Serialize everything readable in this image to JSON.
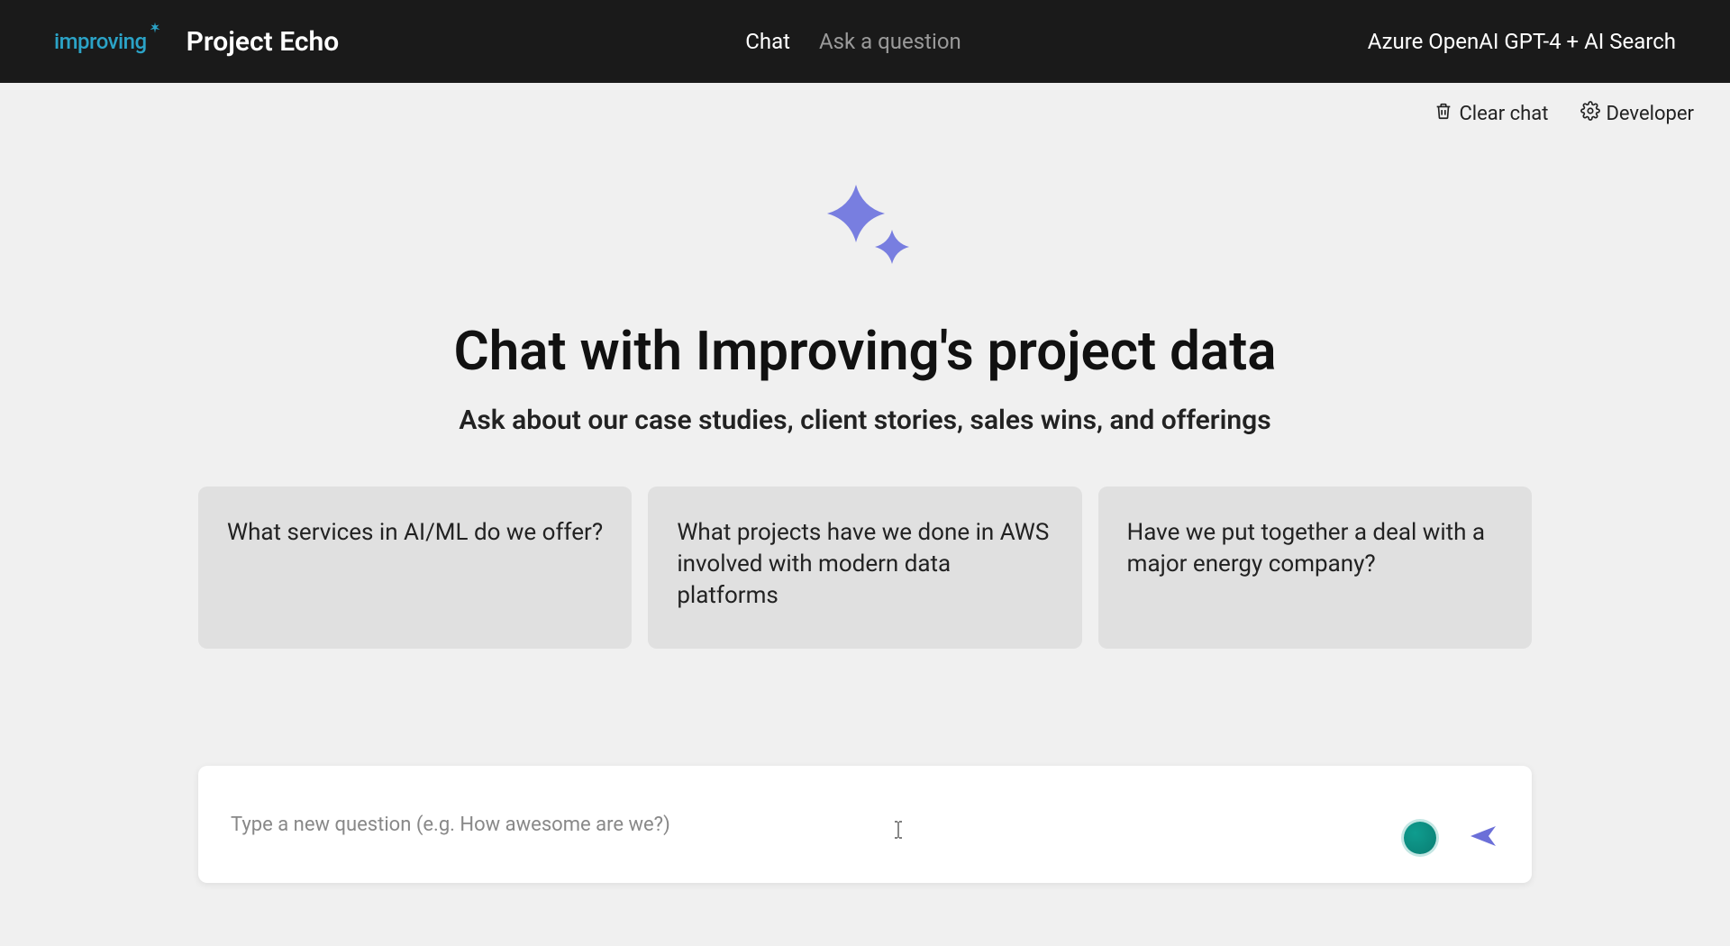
{
  "header": {
    "logo_text": "improving",
    "project_title": "Project Echo",
    "nav": {
      "chat": "Chat",
      "ask": "Ask a question"
    },
    "right_label": "Azure OpenAI GPT-4 + AI Search"
  },
  "toolbar": {
    "clear_chat": "Clear chat",
    "developer": "Developer"
  },
  "main": {
    "headline": "Chat with Improving's project data",
    "subheadline": "Ask about our case studies, client stories, sales wins, and offerings"
  },
  "suggestions": [
    "What services in AI/ML do we offer?",
    "What projects have we done in AWS involved with modern data platforms",
    "Have we put together a deal with a major energy company?"
  ],
  "input": {
    "placeholder": "Type a new question (e.g. How awesome are we?)",
    "value": ""
  },
  "colors": {
    "sparkle": "#787ee0",
    "logo": "#2ba3c7",
    "send": "#6b6fd8",
    "orb": "#0f9d8f"
  }
}
